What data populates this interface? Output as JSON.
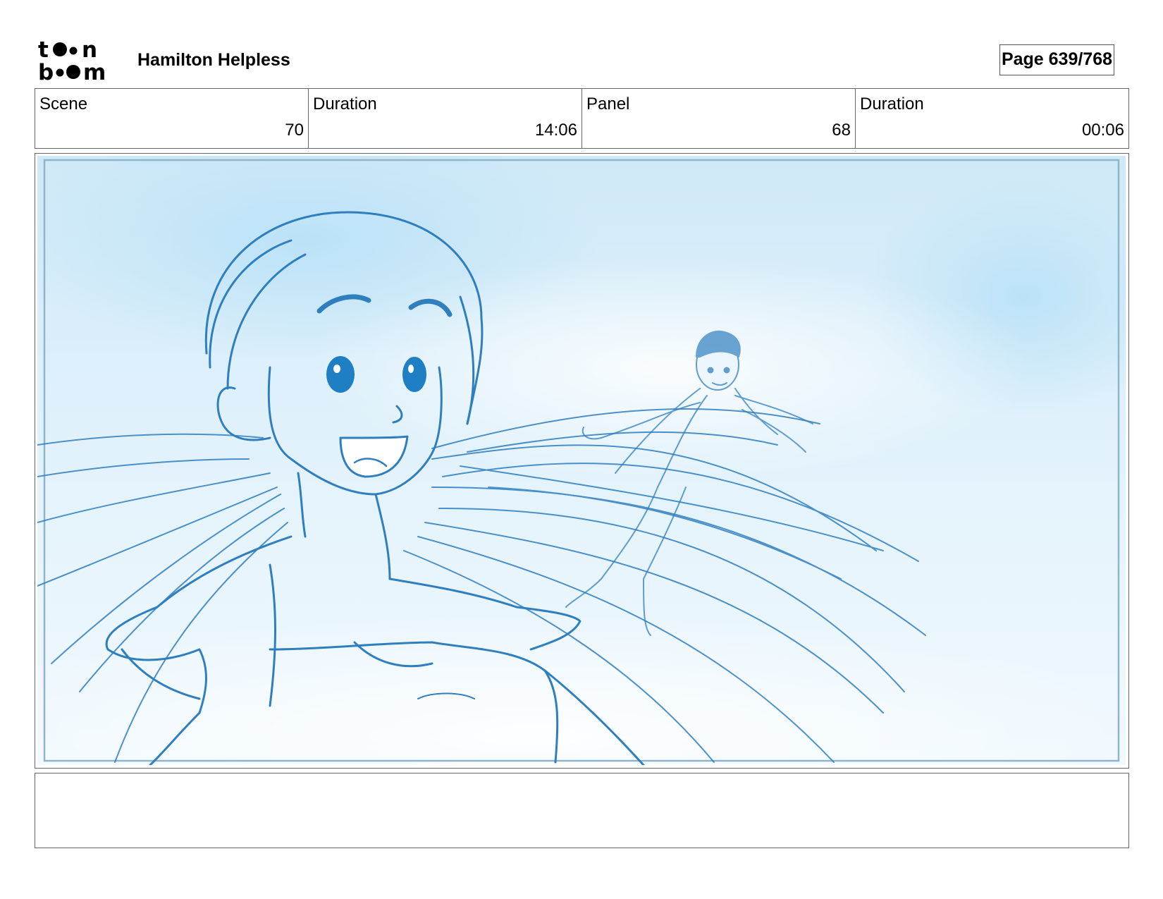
{
  "header": {
    "logo_text": "toonboom",
    "project_title": "Hamilton Helpless",
    "page_label": "Page 639/768"
  },
  "info": [
    {
      "label": "Scene",
      "value": "70"
    },
    {
      "label": "Duration",
      "value": "14:06"
    },
    {
      "label": "Panel",
      "value": "68"
    },
    {
      "label": "Duration",
      "value": "00:06"
    }
  ],
  "panel": {
    "sky_color": "#d9eefa",
    "line_color": "#2f7fbf",
    "iris_color": "#1e7fc4"
  },
  "notes": {
    "text": ""
  }
}
